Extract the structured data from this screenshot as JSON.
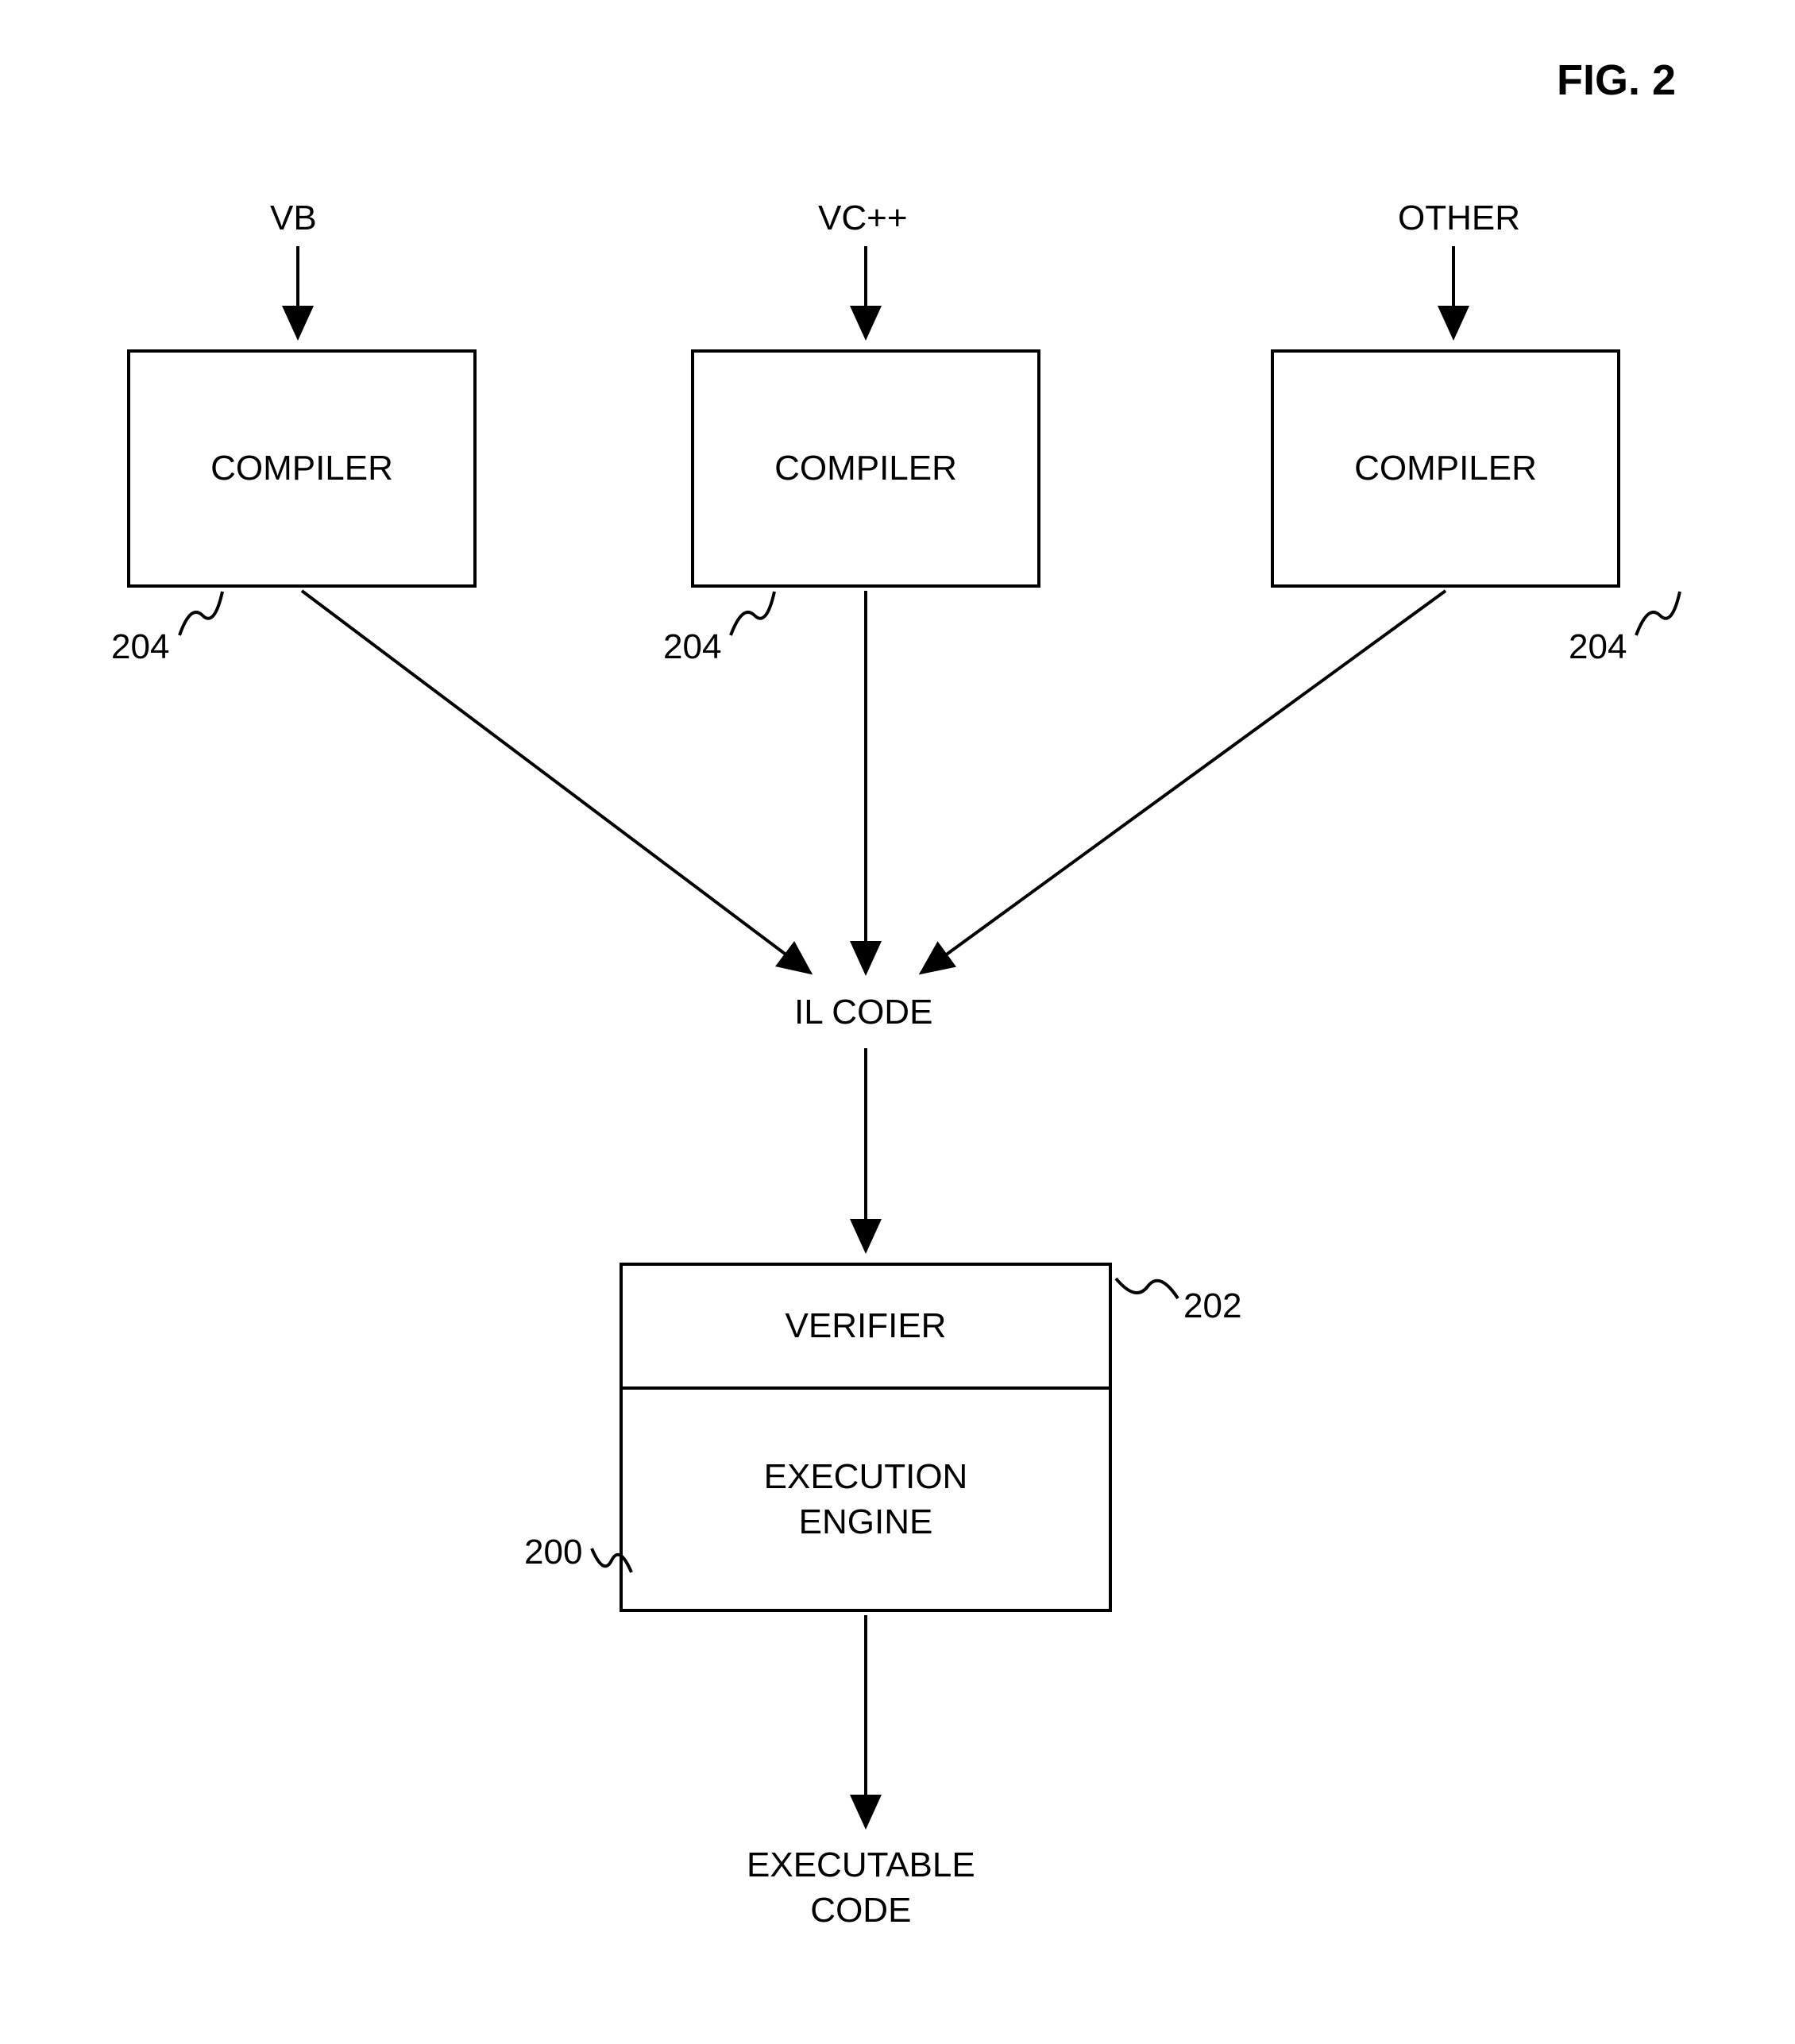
{
  "figure_title": "FIG. 2",
  "sources": {
    "vb": "VB",
    "vcpp": "VC++",
    "other": "OTHER"
  },
  "compiler_label": "COMPILER",
  "il_code": "IL CODE",
  "verifier": "VERIFIER",
  "execution_engine": "EXECUTION\nENGINE",
  "executable_code": "EXECUTABLE\nCODE",
  "refs": {
    "compiler": "204",
    "verifier": "202",
    "engine": "200"
  }
}
